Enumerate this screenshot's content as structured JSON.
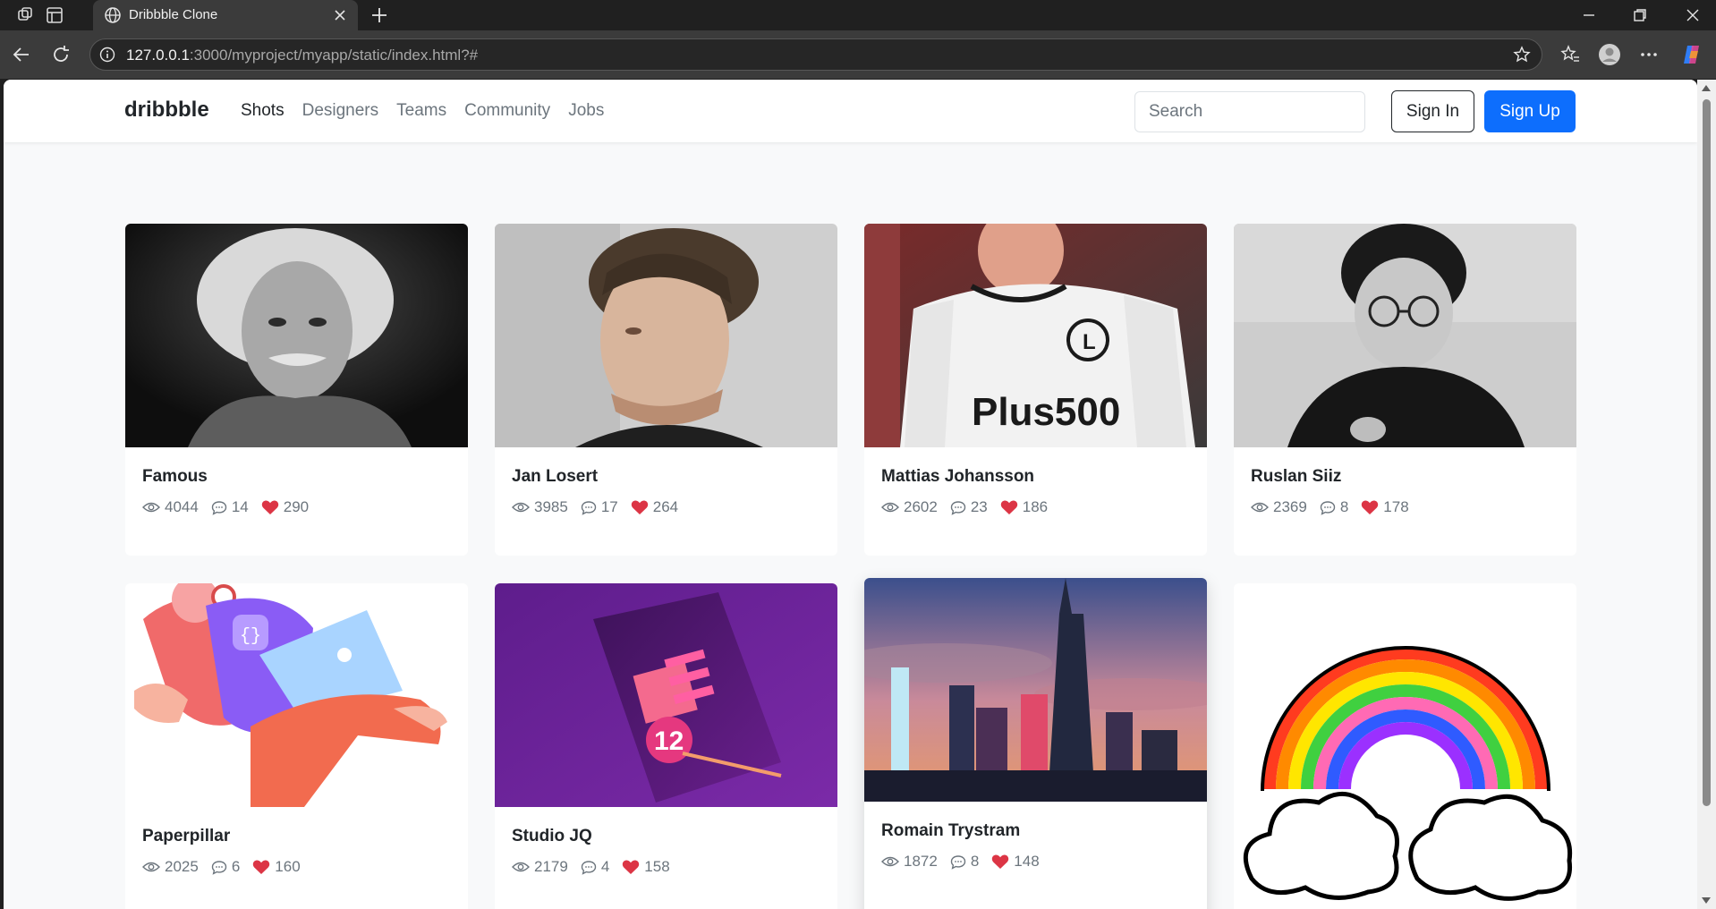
{
  "browser": {
    "tab_title": "Dribbble Clone",
    "url_host": "127.0.0.1",
    "url_rest": ":3000/myproject/myapp/static/index.html?#"
  },
  "navbar": {
    "brand": "dribbble",
    "links": [
      "Shots",
      "Designers",
      "Teams",
      "Community",
      "Jobs"
    ],
    "active_link": "Shots",
    "search_placeholder": "Search",
    "sign_in": "Sign In",
    "sign_up": "Sign Up"
  },
  "colors": {
    "primary": "#0d6efd",
    "heart": "#dc3545",
    "muted": "#6c757d",
    "page_bg": "#f8f9fa"
  },
  "shots": [
    {
      "name": "Famous",
      "views": "4044",
      "comments": "14",
      "likes": "290",
      "image": "bw-portrait-elderly-man"
    },
    {
      "name": "Jan Losert",
      "views": "3985",
      "comments": "17",
      "likes": "264",
      "image": "portrait-man-profile"
    },
    {
      "name": "Mattias Johansson",
      "views": "2602",
      "comments": "23",
      "likes": "186",
      "image": "football-player"
    },
    {
      "name": "Ruslan Siiz",
      "views": "2369",
      "comments": "8",
      "likes": "178",
      "image": "bw-portrait-man-glasses"
    },
    {
      "name": "Paperpillar",
      "views": "2025",
      "comments": "6",
      "likes": "160",
      "image": "illustration-person-laptop"
    },
    {
      "name": "Studio JQ",
      "views": "2179",
      "comments": "4",
      "likes": "158",
      "image": "purple-poster-12"
    },
    {
      "name": "Romain Trystram",
      "views": "1872",
      "comments": "8",
      "likes": "148",
      "image": "city-skyline"
    },
    {
      "name": "",
      "views": "",
      "comments": "",
      "likes": "",
      "image": "rainbow-clouds"
    }
  ]
}
